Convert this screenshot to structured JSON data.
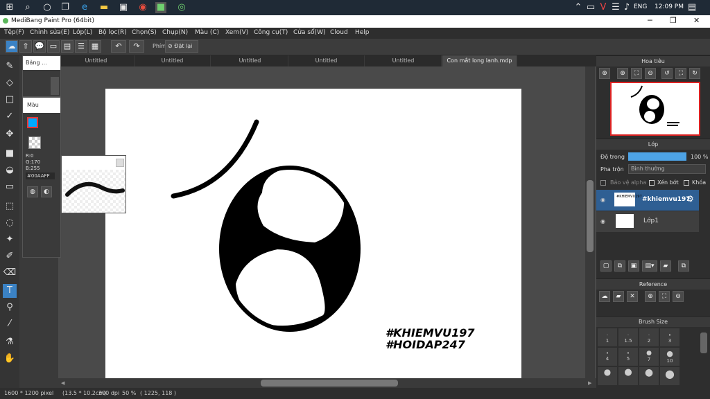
{
  "taskbar": {
    "icons": [
      "windows-icon",
      "search-icon",
      "cortana-icon",
      "task-view-icon",
      "edge-icon",
      "file-explorer-icon",
      "store-icon",
      "chrome-icon",
      "medibang-icon",
      "app-icon"
    ],
    "language": "ENG",
    "time": "12:09 PM"
  },
  "window": {
    "title": "MediBang Paint Pro (64bit)"
  },
  "menu": [
    "Tệp(F)",
    "Chỉnh sửa(E)",
    "Lớp(L)",
    "Bộ lọc(R)",
    "Chọn(S)",
    "Chụp(N)",
    "Màu (C)",
    "Xem(V)",
    "Công cụ(T)",
    "Cửa sổ(W)",
    "Cloud",
    "Help"
  ],
  "toolbar": {
    "shortcut_label": "Phím",
    "reset_label": "Đặt lại"
  },
  "tabs": [
    "Untitled",
    "Untitled",
    "Untitled",
    "Untitled",
    "Untitled",
    "Con mắt long lanh.mdp"
  ],
  "floating": {
    "brush_panel_title": "Bảng ...",
    "color_panel_title": "Màu",
    "color_r": "R:0",
    "color_g": "G:170",
    "color_b": "B:255",
    "color_hex": "#00AAFF",
    "fg_color": "#00aaff"
  },
  "canvas": {
    "watermark_line1": "#KHIEMVU197",
    "watermark_line2": "#HOIDAP247"
  },
  "right": {
    "navigator_title": "Hoa tiêu",
    "layer_title": "Lớp",
    "opacity_label": "Độ trong",
    "opacity_value": "100 %",
    "blend_label": "Pha trộn",
    "blend_value": "Bình thường",
    "protect_alpha": "Bảo vệ alpha",
    "clipping": "Xén bớt",
    "lock": "Khóa",
    "layers": [
      {
        "name": "#khiemvu197",
        "selected": true
      },
      {
        "name": "Lớp1",
        "selected": false
      }
    ],
    "reference_title": "Reference",
    "brush_size_title": "Brush Size",
    "brush_sizes": [
      "1",
      "1.5",
      "2",
      "3",
      "4",
      "5",
      "7",
      "10"
    ]
  },
  "status": {
    "size": "1600 * 1200 pixel",
    "cm": "(13.5 * 10.2cm)",
    "dpi": "300 dpi",
    "zoom": "50 %",
    "coords": "( 1225, 118 )"
  }
}
